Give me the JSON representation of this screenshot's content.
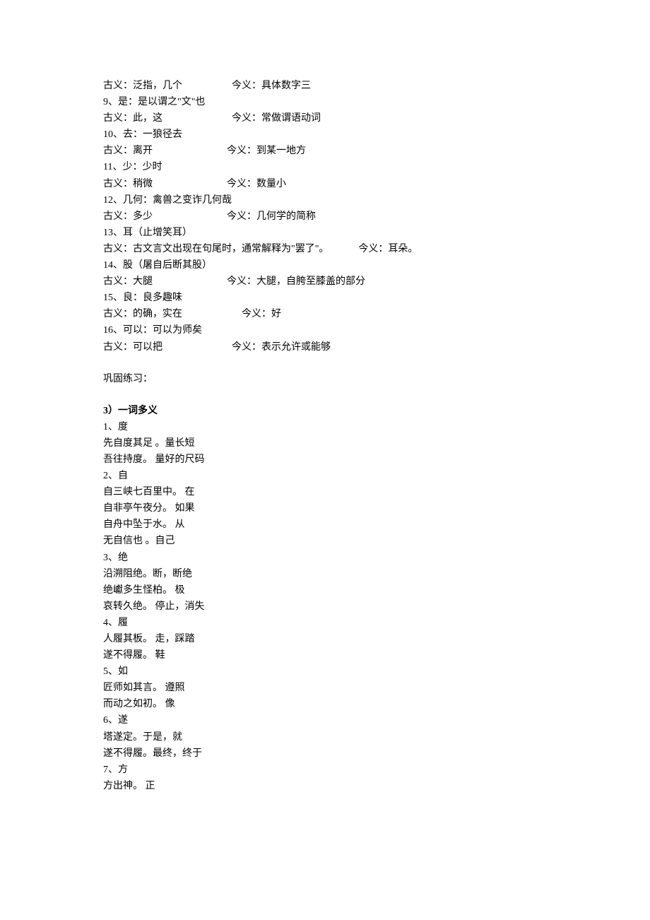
{
  "top": {
    "item_pre": {
      "gu": "古义：泛指，几个",
      "jin": "今义：具体数字三"
    },
    "items": [
      {
        "num": "9",
        "word": "是",
        "ex": "是以谓之\"文\"也",
        "gu": "此，这",
        "jin": "常做谓语动词"
      },
      {
        "num": "10",
        "word": "去",
        "ex": "一狼径去",
        "gu": "离开",
        "jin": "到某一地方"
      },
      {
        "num": "11",
        "word": "少",
        "ex": "少时",
        "gu": "稍微",
        "jin": "数量小"
      },
      {
        "num": "12",
        "word": "几何",
        "ex": "禽兽之变诈几何哉",
        "gu": "多少",
        "jin": "几何学的简称"
      },
      {
        "num": "13",
        "word": "耳",
        "ex": "（止增笑耳）",
        "gu_full": "古义：古文言文出现在句尾时，通常解释为\"罢了\"。",
        "jin_full": "今义：耳朵。"
      },
      {
        "num": "14、",
        "word": "股",
        "ex": "（屠自后断其股）",
        "gu": "大腿",
        "jin": "大腿，自胯至膝盖的部分"
      },
      {
        "num": "15",
        "word": "良",
        "ex": "良多趣味",
        "gu": "的确，实在",
        "jin": "好"
      },
      {
        "num": "16",
        "word": "可以",
        "ex": "可以为师矣",
        "gu": "可以把",
        "jin": "表示允许或能够"
      }
    ]
  },
  "practice": "巩固练习：",
  "section3": {
    "heading": "3）一词多义",
    "entries": [
      {
        "num": "1",
        "word": "度",
        "lines": [
          "先自度其足 。量长短",
          "吾往持度。 量好的尺码"
        ]
      },
      {
        "num": "2",
        "word": "自",
        "lines": [
          "自三峡七百里中。 在",
          "自非亭午夜分。 如果",
          "自舟中坠于水。 从",
          "无自信也 。自己"
        ]
      },
      {
        "num": "3",
        "word": "绝",
        "lines": [
          "沿溯阻绝。断，断绝",
          "绝巘多生怪柏。 极",
          "哀转久绝。 停止，消失"
        ]
      },
      {
        "num": "4",
        "word": "履",
        "lines": [
          "人履其板。 走，踩踏",
          "遂不得履。 鞋"
        ]
      },
      {
        "num": "5",
        "word": "如",
        "lines": [
          "匠师如其言。 遵照",
          "而动之如初。 像"
        ]
      },
      {
        "num": "6",
        "word": "遂",
        "lines": [
          "塔遂定。于是，就",
          "遂不得履。最终，终于"
        ]
      },
      {
        "num": "7",
        "word": "方",
        "lines": [
          "方出神。 正"
        ]
      }
    ]
  }
}
